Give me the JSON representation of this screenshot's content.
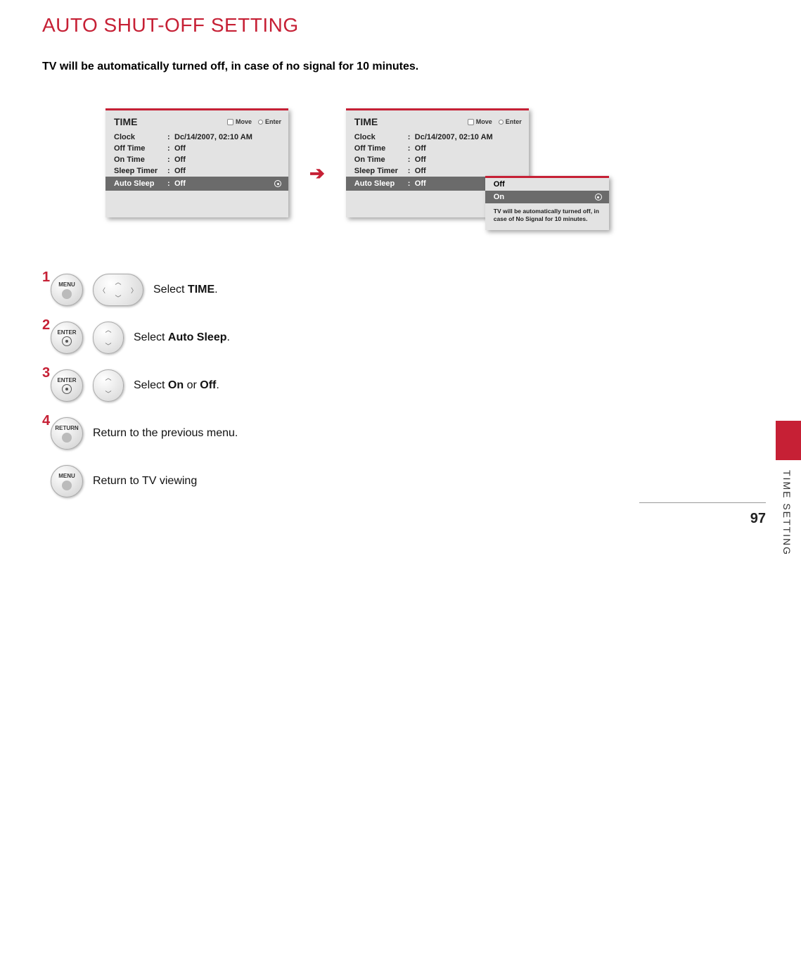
{
  "page": {
    "title": "AUTO SHUT-OFF SETTING",
    "subtitle": "TV will be automatically turned off, in case of no signal for 10 minutes.",
    "side_label": "TIME SETTING",
    "page_number": "97"
  },
  "panel_left": {
    "title": "TIME",
    "move": "Move",
    "enter": "Enter",
    "rows": [
      {
        "label": "Clock",
        "value": "Dc/14/2007, 02:10 AM"
      },
      {
        "label": "Off Time",
        "value": "Off"
      },
      {
        "label": "On Time",
        "value": "Off"
      },
      {
        "label": "Sleep Timer",
        "value": "Off"
      },
      {
        "label": "Auto Sleep",
        "value": "Off"
      }
    ]
  },
  "panel_right": {
    "title": "TIME",
    "move": "Move",
    "enter": "Enter",
    "rows": [
      {
        "label": "Clock",
        "value": "Dc/14/2007, 02:10 AM"
      },
      {
        "label": "Off Time",
        "value": "Off"
      },
      {
        "label": "On Time",
        "value": "Off"
      },
      {
        "label": "Sleep Timer",
        "value": "Off"
      },
      {
        "label": "Auto Sleep",
        "value": "Off"
      }
    ],
    "popup": {
      "off": "Off",
      "on": "On",
      "msg": "TV will be automatically turned off, in case of No Signal for 10 minutes."
    }
  },
  "steps": [
    {
      "num": "1",
      "btn": "MENU",
      "text_pre": "Select ",
      "bold": "TIME",
      "text_post": ".",
      "dpad": "full"
    },
    {
      "num": "2",
      "btn": "ENTER",
      "text_pre": "Select ",
      "bold": "Auto Sleep",
      "text_post": ".",
      "dpad": "ud"
    },
    {
      "num": "3",
      "btn": "ENTER",
      "text_pre": "Select ",
      "bold": "On",
      "mid": " or ",
      "bold2": "Off",
      "text_post": ".",
      "dpad": "ud"
    },
    {
      "num": "4",
      "btn": "RETURN",
      "text_pre": "Return to the previous menu."
    },
    {
      "num": "",
      "btn": "MENU",
      "text_pre": "Return to TV viewing"
    }
  ]
}
